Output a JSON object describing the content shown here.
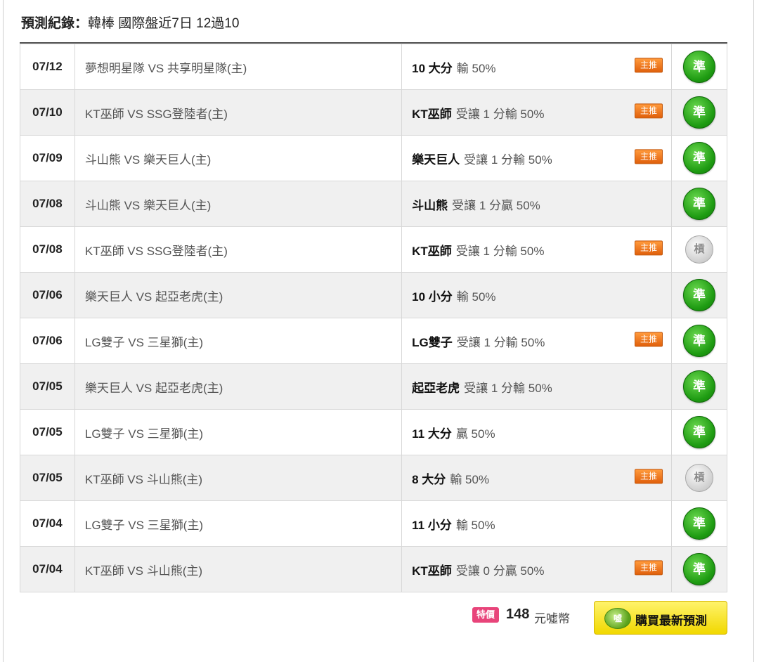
{
  "header": {
    "title_strong": "預測紀錄：",
    "title_rest": "韓棒 國際盤近7日 12過10"
  },
  "rows": [
    {
      "date": "07/12",
      "match": "夢想明星隊 VS 共享明星隊(主)",
      "pick_main": "10 大分",
      "pick_sub": "輸 50%",
      "badge": "主推",
      "result": "準",
      "result_type": "green"
    },
    {
      "date": "07/10",
      "match": "KT巫師 VS SSG登陸者(主)",
      "pick_main": "KT巫師",
      "pick_sub": "受讓 1 分輸 50%",
      "badge": "主推",
      "result": "準",
      "result_type": "green"
    },
    {
      "date": "07/09",
      "match": "斗山熊 VS 樂天巨人(主)",
      "pick_main": "樂天巨人",
      "pick_sub": "受讓 1 分輸 50%",
      "badge": "主推",
      "result": "準",
      "result_type": "green"
    },
    {
      "date": "07/08",
      "match": "斗山熊 VS 樂天巨人(主)",
      "pick_main": "斗山熊",
      "pick_sub": "受讓 1 分贏 50%",
      "badge": "",
      "result": "準",
      "result_type": "green"
    },
    {
      "date": "07/08",
      "match": "KT巫師 VS SSG登陸者(主)",
      "pick_main": "KT巫師",
      "pick_sub": "受讓 1 分輸 50%",
      "badge": "主推",
      "result": "槓",
      "result_type": "gray"
    },
    {
      "date": "07/06",
      "match": "樂天巨人 VS 起亞老虎(主)",
      "pick_main": "10 小分",
      "pick_sub": "輸 50%",
      "badge": "",
      "result": "準",
      "result_type": "green"
    },
    {
      "date": "07/06",
      "match": "LG雙子 VS 三星獅(主)",
      "pick_main": "LG雙子",
      "pick_sub": "受讓 1 分輸 50%",
      "badge": "主推",
      "result": "準",
      "result_type": "green"
    },
    {
      "date": "07/05",
      "match": "樂天巨人 VS 起亞老虎(主)",
      "pick_main": "起亞老虎",
      "pick_sub": "受讓 1 分輸 50%",
      "badge": "",
      "result": "準",
      "result_type": "green"
    },
    {
      "date": "07/05",
      "match": "LG雙子 VS 三星獅(主)",
      "pick_main": "11 大分",
      "pick_sub": "贏 50%",
      "badge": "",
      "result": "準",
      "result_type": "green"
    },
    {
      "date": "07/05",
      "match": "KT巫師 VS 斗山熊(主)",
      "pick_main": "8 大分",
      "pick_sub": "輸 50%",
      "badge": "主推",
      "result": "槓",
      "result_type": "gray"
    },
    {
      "date": "07/04",
      "match": "LG雙子 VS 三星獅(主)",
      "pick_main": "11 小分",
      "pick_sub": "輸 50%",
      "badge": "",
      "result": "準",
      "result_type": "green"
    },
    {
      "date": "07/04",
      "match": "KT巫師 VS 斗山熊(主)",
      "pick_main": "KT巫師",
      "pick_sub": "受讓 0 分贏 50%",
      "badge": "主推",
      "result": "準",
      "result_type": "green"
    }
  ],
  "footer": {
    "special_label": "特價",
    "price": "148",
    "price_unit": "元噓幣",
    "buy_icon": "噓",
    "buy_label": "購買最新預測"
  },
  "colors": {
    "badge": "#e0600c",
    "result_green": "#1e9b12",
    "result_gray": "#cfcfcf",
    "special": "#e8447a",
    "buy_button": "#f1d800"
  }
}
